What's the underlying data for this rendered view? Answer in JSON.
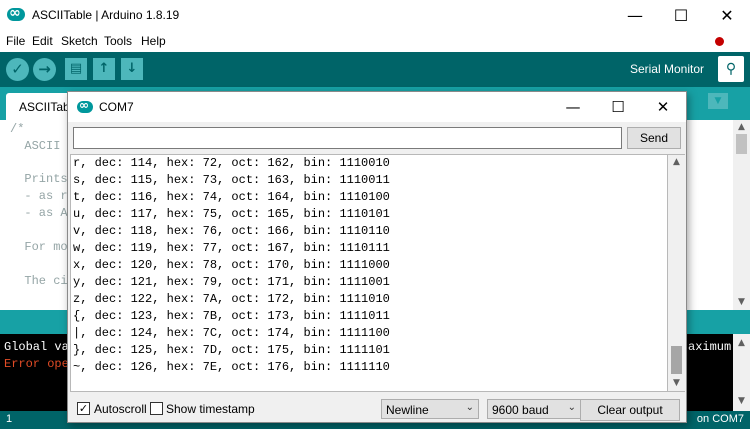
{
  "ide": {
    "title": "ASCIITable | Arduino 1.8.19",
    "menu": [
      "File",
      "Edit",
      "Sketch",
      "Tools",
      "Help"
    ],
    "serial_monitor_label": "Serial Monitor",
    "sketch_tab": "ASCIITable",
    "editor_lines": [
      "/*",
      "  ASCII",
      "",
      "  Prints",
      "  - as r",
      "  - as A",
      "",
      "  For mo",
      "",
      "  The ci"
    ],
    "console_lines": [
      {
        "text": "Global va",
        "color": "#ffffff"
      },
      {
        "text": "Error ope",
        "color": "#e34c26"
      }
    ],
    "console_right_text": "aximum",
    "status_left": "1",
    "status_right": "on COM7"
  },
  "serial_monitor": {
    "title": "COM7",
    "input_value": "",
    "send_label": "Send",
    "output_lines": [
      "r, dec: 114, hex: 72, oct: 162, bin: 1110010",
      "s, dec: 115, hex: 73, oct: 163, bin: 1110011",
      "t, dec: 116, hex: 74, oct: 164, bin: 1110100",
      "u, dec: 117, hex: 75, oct: 165, bin: 1110101",
      "v, dec: 118, hex: 76, oct: 166, bin: 1110110",
      "w, dec: 119, hex: 77, oct: 167, bin: 1110111",
      "x, dec: 120, hex: 78, oct: 170, bin: 1111000",
      "y, dec: 121, hex: 79, oct: 171, bin: 1111001",
      "z, dec: 122, hex: 7A, oct: 172, bin: 1111010",
      "{, dec: 123, hex: 7B, oct: 173, bin: 1111011",
      "|, dec: 124, hex: 7C, oct: 174, bin: 1111100",
      "}, dec: 125, hex: 7D, oct: 175, bin: 1111101",
      "~, dec: 126, hex: 7E, oct: 176, bin: 1111110"
    ],
    "autoscroll_label": "Autoscroll",
    "autoscroll_checked": true,
    "timestamp_label": "Show timestamp",
    "timestamp_checked": false,
    "line_ending": "Newline",
    "baud_rate": "9600 baud",
    "clear_label": "Clear output"
  }
}
